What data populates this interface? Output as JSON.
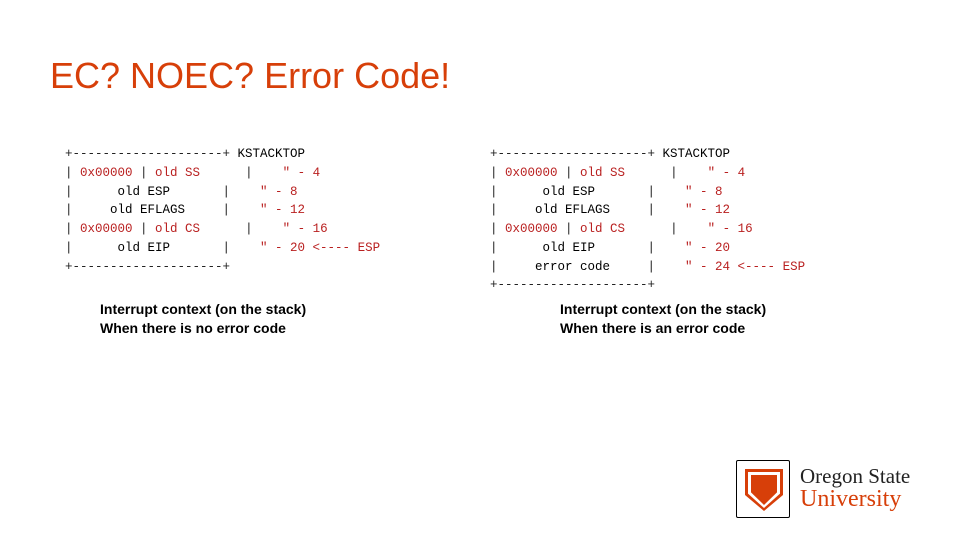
{
  "title": "EC? NOEC? Error Code!",
  "left_diagram": {
    "kstacktop": "KSTACKTOP",
    "rows": [
      {
        "col0": "0x00000",
        "col1": "old SS",
        "off": "\" - 4"
      },
      {
        "col0": "",
        "col1": "old ESP",
        "off": "\" - 8"
      },
      {
        "col0": "",
        "col1": "old EFLAGS",
        "off": "\" - 12"
      },
      {
        "col0": "0x00000",
        "col1": "old CS",
        "off": "\" - 16"
      },
      {
        "col0": "",
        "col1": "old EIP",
        "off": "\" - 20 <---- ESP"
      }
    ]
  },
  "right_diagram": {
    "kstacktop": "KSTACKTOP",
    "rows": [
      {
        "col0": "0x00000",
        "col1": "old SS",
        "off": "\" - 4"
      },
      {
        "col0": "",
        "col1": "old ESP",
        "off": "\" - 8"
      },
      {
        "col0": "",
        "col1": "old EFLAGS",
        "off": "\" - 12"
      },
      {
        "col0": "0x00000",
        "col1": "old CS",
        "off": "\" - 16"
      },
      {
        "col0": "",
        "col1": "old EIP",
        "off": "\" - 20"
      },
      {
        "col0": "",
        "col1": "error code",
        "off": "\" - 24 <---- ESP"
      }
    ]
  },
  "caption_left": {
    "line1": "Interrupt context (on the stack)",
    "line2": "When there is no error code"
  },
  "caption_right": {
    "line1": "Interrupt context (on the stack)",
    "line2": "When there is an error code"
  },
  "logo": {
    "line1": "Oregon State",
    "line2": "University"
  },
  "colors": {
    "accent": "#d73f09",
    "red_value": "#b92020"
  }
}
